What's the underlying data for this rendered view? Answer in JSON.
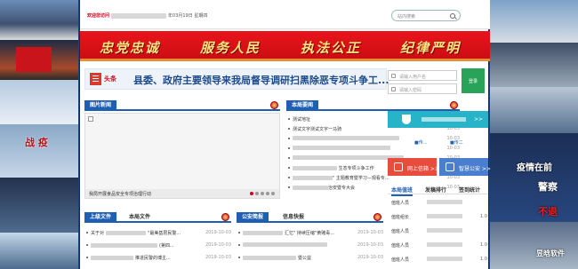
{
  "header": {
    "date_suffix": "年03月19日 星期四",
    "search_placeholder": "站内搜索"
  },
  "banner": {
    "slogans": [
      "忠党忠诚",
      "服务人民",
      "执法公正",
      "纪律严明"
    ]
  },
  "headline": {
    "tag": "头条",
    "title": "县委、政府主要领导来我局督导调研扫黑除恶专项斗争工..."
  },
  "picture_news": {
    "tab": "图片新闻",
    "caption": "我局开展食品安全专项治理行动",
    "slide_count": 5,
    "active_slide": 1
  },
  "bureau_news": {
    "tab": "本局要闻",
    "items": [
      {
        "text": "测试地址",
        "date": "10-03"
      },
      {
        "text": "测试文字测试文字一马骑",
        "date": "10-03"
      },
      {
        "text": "",
        "date": "10-03"
      },
      {
        "text": "",
        "date": "10-03"
      },
      {
        "text": "",
        "date": "10-03"
      },
      {
        "text": "生态专项斗争工作",
        "date": "10-03"
      },
      {
        "text": "\" 主题教育暨学习—观看专...",
        "date": "10-03"
      },
      {
        "text": "治安暨专大会",
        "date": "10-03"
      }
    ]
  },
  "upper_docs": {
    "tab_active": "上级文件",
    "tab_other": "本局文件",
    "items": [
      {
        "text": "关于对",
        "mid": "\"最美基层民警...",
        "date": "2019-10-03"
      },
      {
        "text": "",
        "mid": "(第四...",
        "date": "2019-10-03"
      },
      {
        "text": "",
        "mid": "推进民警的博主...",
        "date": "2019-10-03"
      }
    ]
  },
  "public_news": {
    "tab_active": "公安简报",
    "tab_other": "信息快报",
    "items": [
      {
        "text": "汇忆\" 持续压缩\"黄赌毒...",
        "date": "2019-10-03"
      },
      {
        "text": "",
        "date": "2019-10-03"
      },
      {
        "text": "暨公益",
        "date": "2019-10-03"
      }
    ]
  },
  "login": {
    "username_placeholder": "请输入用户名",
    "password_placeholder": "请输入密码",
    "login_label": "登录"
  },
  "member": {
    "arrow": ">>",
    "link1": "■传...",
    "link2": "■传二"
  },
  "quick_buttons": [
    {
      "label": "网上信箱 >>",
      "color": "#e74c3c"
    },
    {
      "label": "智慧公安 >>",
      "color": "#4a7fd0"
    }
  ],
  "rank": {
    "tabs": [
      "本局值班",
      "发稿排行",
      "签到统计"
    ],
    "active": 0,
    "rows": [
      {
        "name": "值班人员",
        "count": ""
      },
      {
        "name": "值班组长",
        "count": "1.0"
      },
      {
        "name": "值班人员",
        "count": ""
      },
      {
        "name": "值班人员",
        "count": "1.0"
      },
      {
        "name": "值班人员",
        "count": "1.0"
      }
    ]
  },
  "photos_right": {
    "line1": "疫情在前",
    "line2": "警察",
    "line3": "不退"
  },
  "photos_left": {
    "text": "战 疫"
  },
  "watermark": "昱晗软件"
}
